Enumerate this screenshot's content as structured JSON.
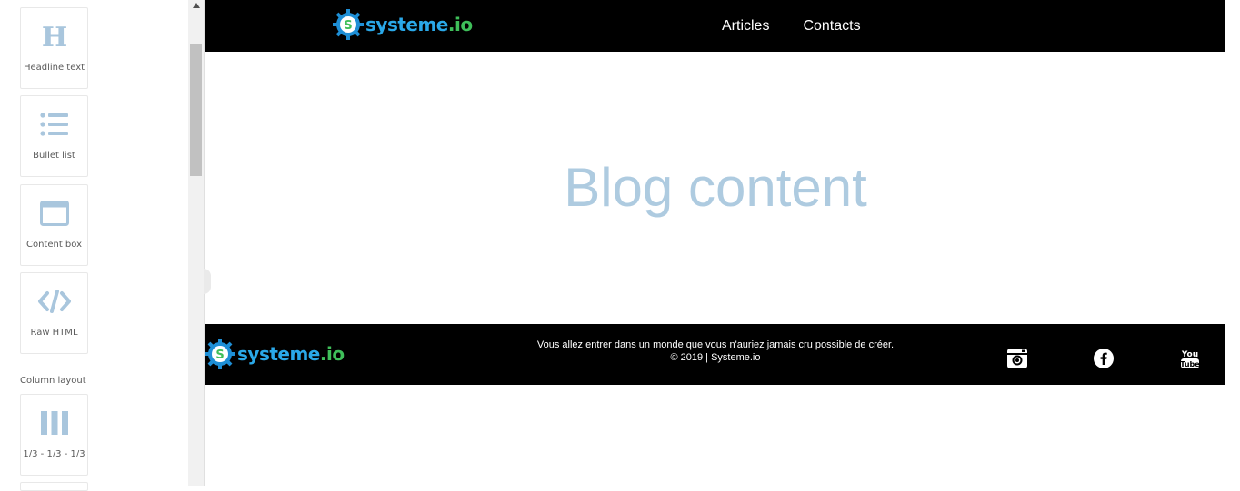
{
  "left_panel": {
    "blocks": [
      {
        "label": "Headline text",
        "icon": "heading-icon"
      },
      {
        "label": "Bullet list",
        "icon": "bullet-list-icon"
      },
      {
        "label": "Content box",
        "icon": "content-box-icon"
      },
      {
        "label": "Raw HTML",
        "icon": "code-icon"
      }
    ],
    "section_title": "Column layout",
    "layout_blocks": [
      {
        "label": "1/3 - 1/3 - 1/3",
        "icon": "three-columns-icon"
      }
    ]
  },
  "header": {
    "logo": {
      "brand": "systeme",
      "tld": ".io"
    },
    "nav": [
      "Articles",
      "Contacts"
    ]
  },
  "blog": {
    "title": "Blog content"
  },
  "footer": {
    "logo": {
      "brand": "systeme",
      "tld": ".io"
    },
    "tagline": "Vous allez entrer dans un monde que vous n'auriez jamais cru possible de créer.",
    "copyright": "© 2019 | Systeme.io",
    "social": [
      "instagram-icon",
      "facebook-icon",
      "youtube-icon"
    ]
  },
  "colors": {
    "icon_blue": "#a9c6dd",
    "logo_blue": "#2aa8e8",
    "logo_green": "#3fbf5a",
    "blog_title": "#aecbe0",
    "header_bg": "#000000"
  }
}
